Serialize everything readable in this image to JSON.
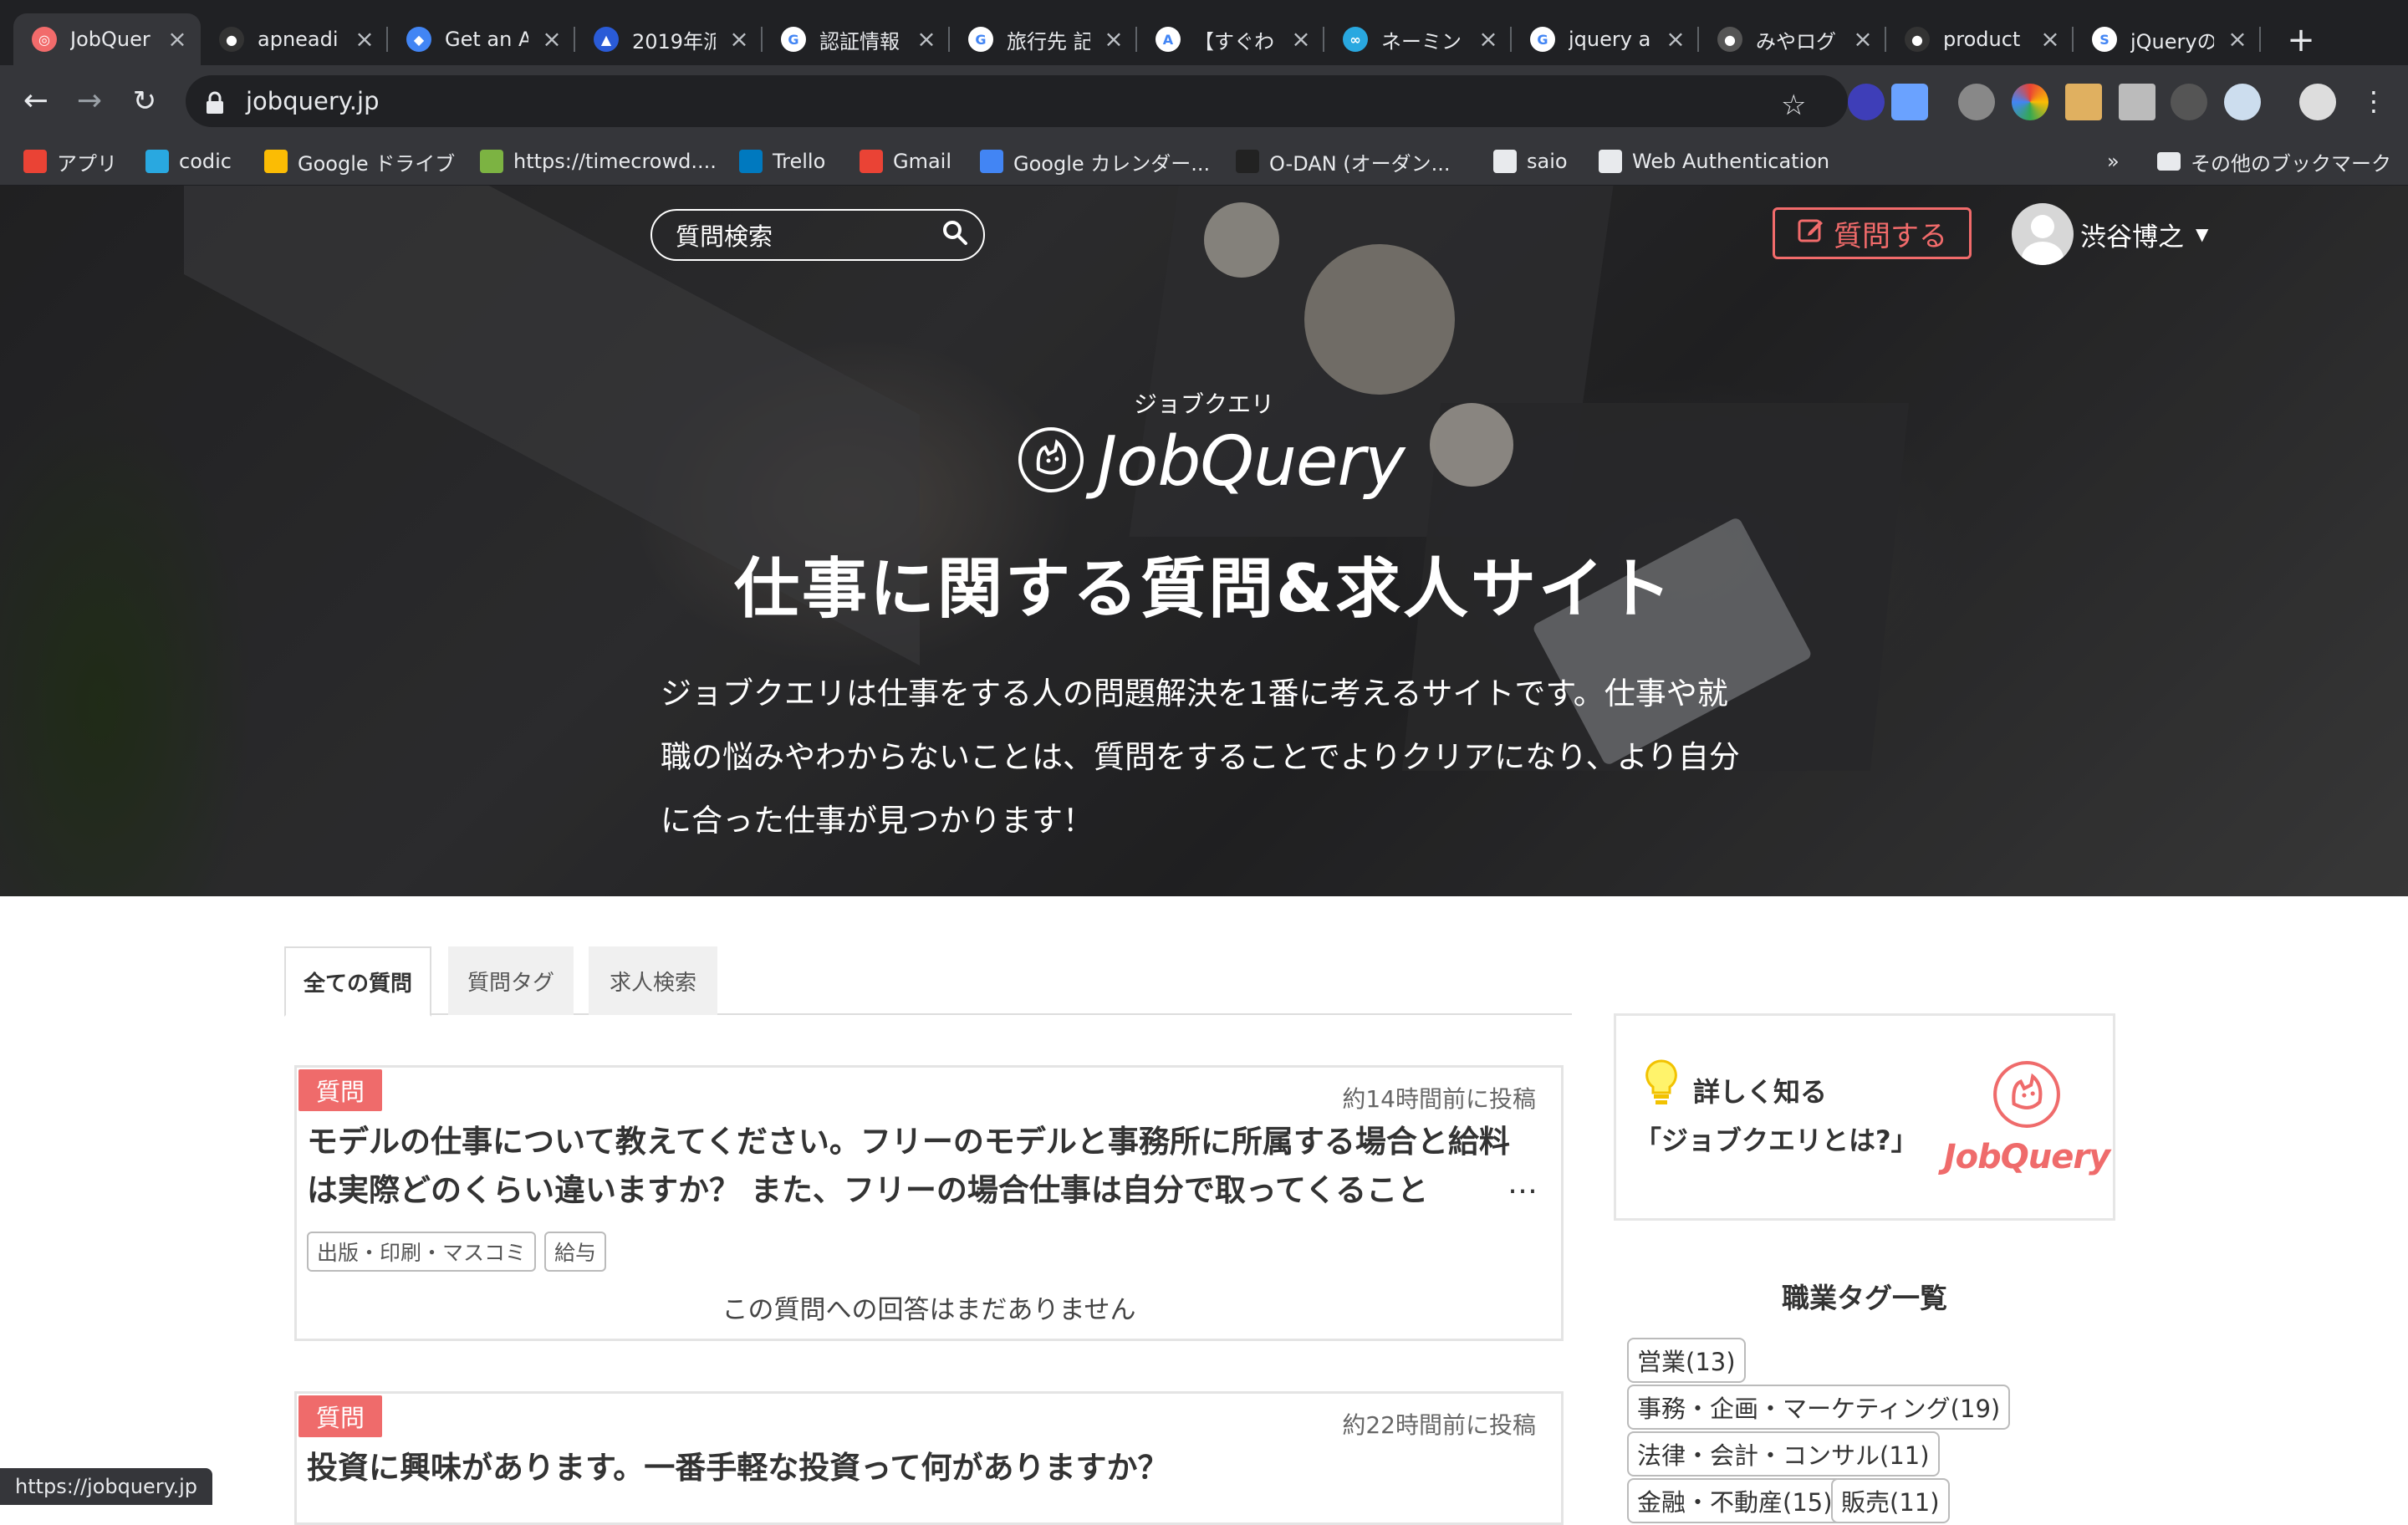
{
  "browser": {
    "tabs": [
      {
        "title": "JobQuer",
        "fav_color": "#f26b6b",
        "fav_glyph": "◎"
      },
      {
        "title": "apneadi",
        "fav_color": "#333333",
        "fav_glyph": "●"
      },
      {
        "title": "Get an A",
        "fav_color": "#4285f4",
        "fav_glyph": "◆"
      },
      {
        "title": "2019年派",
        "fav_color": "#2a5bd7",
        "fav_glyph": "▲"
      },
      {
        "title": "認証情報",
        "fav_color": "#ffffff",
        "fav_glyph": "G"
      },
      {
        "title": "旅行先 記",
        "fav_color": "#ffffff",
        "fav_glyph": "G"
      },
      {
        "title": "【すぐわ",
        "fav_color": "#ffffff",
        "fav_glyph": "A"
      },
      {
        "title": "ネーミン",
        "fav_color": "#29a8e0",
        "fav_glyph": "∞"
      },
      {
        "title": "jquery a",
        "fav_color": "#ffffff",
        "fav_glyph": "G"
      },
      {
        "title": "みやログ",
        "fav_color": "#555555",
        "fav_glyph": "●"
      },
      {
        "title": "product",
        "fav_color": "#333333",
        "fav_glyph": "●"
      },
      {
        "title": "jQueryの",
        "fav_color": "#ffffff",
        "fav_glyph": "S"
      }
    ],
    "url": "jobquery.jp",
    "bookmarks": [
      {
        "label": "アプリ",
        "icon": "apps-grid-icon",
        "color": "#ea4335"
      },
      {
        "label": "codic",
        "icon": "codic-icon",
        "color": "#29a8e0"
      },
      {
        "label": "Google ドライブ",
        "icon": "drive-icon",
        "color": "#fbbc04"
      },
      {
        "label": "https://timecrowd....",
        "icon": "timecrowd-icon",
        "color": "#7cb342"
      },
      {
        "label": "Trello",
        "icon": "trello-icon",
        "color": "#0079bf"
      },
      {
        "label": "Gmail",
        "icon": "gmail-icon",
        "color": "#ea4335"
      },
      {
        "label": "Google カレンダー...",
        "icon": "calendar-icon",
        "color": "#4285f4"
      },
      {
        "label": "O-DAN (オーダン...",
        "icon": "odan-icon",
        "color": "#222222"
      },
      {
        "label": "saio",
        "icon": "folder-icon",
        "color": "#e8eaed"
      },
      {
        "label": "Web Authentication",
        "icon": "globe-icon",
        "color": "#e8eaed"
      }
    ],
    "bookmarks_overflow": "»",
    "other_bookmarks": "その他のブックマーク",
    "status_url": "https://jobquery.jp"
  },
  "header": {
    "search_placeholder": "質問検索",
    "ask_button": "質問する",
    "user_name": "渋谷博之"
  },
  "hero": {
    "kana": "ジョブクエリ",
    "logo_text": "JobQuery",
    "headline": "仕事に関する質問&求人サイト",
    "intro": "ジョブクエリは仕事をする人の問題解決を1番に考えるサイトです。仕事や就職の悩みやわからないことは、質問をすることでよりクリアになり、より自分に合った仕事が見つかります！"
  },
  "content_tabs": [
    "全ての質問",
    "質問タグ",
    "求人検索"
  ],
  "questions": [
    {
      "badge": "質問",
      "time": "約14時間前に投稿",
      "title": "モデルの仕事について教えてください。フリーのモデルと事務所に所属する場合と給料は実際どのくらい違いますか？ また、フリーの場合仕事は自分で取ってくること",
      "tags": [
        "出版・印刷・マスコミ",
        "給与"
      ],
      "answer_status": "この質問への回答はまだありません"
    },
    {
      "badge": "質問",
      "time": "約22時間前に投稿",
      "title": "投資に興味があります。一番手軽な投資って何がありますか？",
      "tags": [],
      "answer_status": ""
    }
  ],
  "sidebar": {
    "about_title": "詳しく知る",
    "about_sub": "「ジョブクエリとは?」",
    "logo_text": "JobQuery",
    "tag_heading": "職業タグ一覧",
    "job_tags": [
      "営業(13)",
      "事務・企画・マーケティング(19)",
      "法律・会計・コンサル(11)",
      "金融・不動産(15)",
      "販売(11)"
    ]
  },
  "colors": {
    "accent": "#ef6b6b",
    "chrome_dark": "#202124",
    "chrome": "#35363a"
  }
}
